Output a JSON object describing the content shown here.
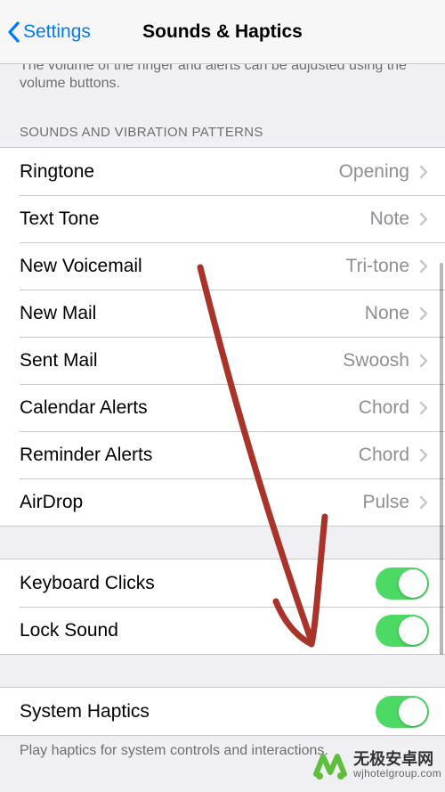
{
  "nav": {
    "back_label": "Settings",
    "title": "Sounds & Haptics"
  },
  "truncated_desc": "The volume of the ringer and alerts can be adjusted using the volume buttons.",
  "section_header_sounds": "SOUNDS AND VIBRATION PATTERNS",
  "rows": {
    "ringtone": {
      "label": "Ringtone",
      "value": "Opening"
    },
    "text_tone": {
      "label": "Text Tone",
      "value": "Note"
    },
    "new_voicemail": {
      "label": "New Voicemail",
      "value": "Tri-tone"
    },
    "new_mail": {
      "label": "New Mail",
      "value": "None"
    },
    "sent_mail": {
      "label": "Sent Mail",
      "value": "Swoosh"
    },
    "calendar_alerts": {
      "label": "Calendar Alerts",
      "value": "Chord"
    },
    "reminder_alerts": {
      "label": "Reminder Alerts",
      "value": "Chord"
    },
    "airdrop": {
      "label": "AirDrop",
      "value": "Pulse"
    }
  },
  "toggles": {
    "keyboard_clicks": {
      "label": "Keyboard Clicks",
      "on": true
    },
    "lock_sound": {
      "label": "Lock Sound",
      "on": true
    },
    "system_haptics": {
      "label": "System Haptics",
      "on": true
    }
  },
  "footer_system_haptics": "Play haptics for system controls and interactions.",
  "watermark": {
    "line1": "无极安卓网",
    "line2": "wjhotelgroup.com"
  },
  "colors": {
    "tint": "#007aff",
    "toggle_on": "#4cd964",
    "separator": "#c8c7cc",
    "secondary_text": "#8e8e93",
    "arrow": "#a93328"
  }
}
